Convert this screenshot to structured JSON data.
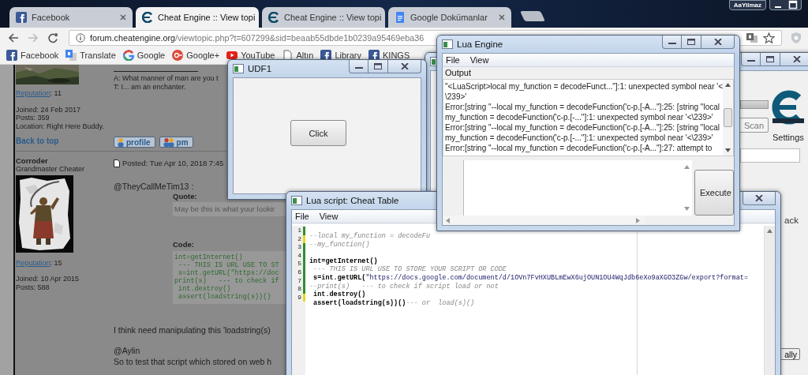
{
  "browser": {
    "tabs": [
      {
        "title": "Facebook",
        "selected": false
      },
      {
        "title": "Cheat Engine :: View topi",
        "selected": true
      },
      {
        "title": "Cheat Engine :: View topi",
        "selected": false
      },
      {
        "title": "Google Dokümanlar",
        "selected": false
      }
    ],
    "user": "AaYilmaz",
    "url": {
      "host": "forum.cheatengine.org",
      "path": "/viewtopic.php?t=607299&sid=beaab55dbde1b0239a95469eba36"
    },
    "bookmarks": [
      {
        "label": "Facebook"
      },
      {
        "label": "Translate"
      },
      {
        "label": "Google"
      },
      {
        "label": "Google+"
      },
      {
        "label": "YouTube"
      },
      {
        "label": "Altın"
      },
      {
        "label": "Library"
      },
      {
        "label": "KINGS"
      }
    ]
  },
  "forum": {
    "previous_post": {
      "reputation_link": "Reputation",
      "reputation_value": ": 11",
      "joined": "Joined: 24 Feb 2017",
      "posts": "Posts: 359",
      "location": "Location: Right Here Buddy.",
      "signature": [
        "A: What manner of man are you t",
        "T: I... am an enchanter."
      ],
      "back_to_top": "Back to top",
      "buttons": [
        "profile",
        "pm"
      ]
    },
    "post": {
      "author": "Corroder",
      "rank": "Grandmaster Cheater",
      "reputation_link": "Reputation",
      "reputation_value": ": 15",
      "joined": "Joined: 10 Apr 2015",
      "posts": "Posts: 588",
      "posted": "Posted: Tue Apr 10, 2018 7:45",
      "body": [
        {
          "kind": "text",
          "text": "@TheyCallMeTim13 :"
        },
        {
          "kind": "quote",
          "label": "Quote:",
          "text": "May be this is what your lookir"
        },
        {
          "kind": "code",
          "label": "Code:",
          "lines": [
            "int=getInternet()",
            " --- THIS IS URL USE TO ST",
            " s=int.getURL(\"https://doc",
            "print(s)   --- to check if",
            " int.destroy()",
            " assert(loadstring(s))()"
          ]
        },
        {
          "kind": "text",
          "text": "I think need manipulating this 'loadstring(s)"
        },
        {
          "kind": "text",
          "text": "@Aylin"
        },
        {
          "kind": "text",
          "text": "So to test that script which stored on web h"
        }
      ]
    }
  },
  "cheat_engine_window": {
    "scan_button": "Scan",
    "settings_label": "Settings",
    "label_fragment": "ack",
    "button_fragment": "ally"
  },
  "udf1_window": {
    "title": "UDF1",
    "button": "Click"
  },
  "lua_engine_window": {
    "title": "Lua Engine",
    "menu": [
      "File",
      "View"
    ],
    "output_label": "Output",
    "output_lines": [
      "\"<LuaScript>local my_function = decodeFunct...\"]:1: unexpected symbol near '<",
      "\\239>'",
      "Error:[string \"--local my_function = decodeFunction('c-p.[-A...\"]:25: [string \"local",
      "my_function = decodeFunction('c-p.[-...\"]:1: unexpected symbol near '<\\239>'",
      "Error:[string \"--local my_function = decodeFunction('c-p.[-A...\"]:25: [string \"local",
      "my_function = decodeFunction('c-p.[-...\"]:1: unexpected symbol near '<\\239>'",
      "Error:[string \"--local my_function = decodeFunction('c-p.[-A...\"]:27: attempt to"
    ],
    "execute_button": "Execute"
  },
  "lua_script_window": {
    "title": "Lua script: Cheat Table",
    "menu": [
      "File",
      "View"
    ],
    "lines": [
      {
        "number": "1",
        "color": "#2f8f2f",
        "segments": [
          {
            "kind": "comment",
            "text": "--local my_function = decodeFu"
          }
        ]
      },
      {
        "number": "2",
        "color": "#e8d81c",
        "segments": [
          {
            "kind": "comment",
            "text": "--my_function()"
          }
        ]
      },
      {
        "number": "3",
        "color": "#2f8f2f"
      },
      {
        "number": "4",
        "color": "#2f8f2f",
        "segments": [
          {
            "kind": "code",
            "text": "int=getInternet()"
          }
        ]
      },
      {
        "number": "5",
        "color": "#2f8f2f",
        "segments": [
          {
            "kind": "comment",
            "text": " --- THIS IS URL USE TO STORE YOUR SCRIPT OR CODE"
          }
        ]
      },
      {
        "number": "6",
        "color": "#2f8f2f",
        "segments": [
          {
            "kind": "code",
            "text": " s=int.getURL("
          },
          {
            "kind": "string",
            "text": "\"https://docs.google.com/document/d/1OVn7FvHXUBLmEwX6ujOUN1OU4WqJdb6eXo9aXGO3ZGw/export?format="
          }
        ]
      },
      {
        "number": "7",
        "color": "#2f8f2f",
        "segments": [
          {
            "kind": "comment",
            "text": "--print(s)   --- to check if script load or not"
          }
        ]
      },
      {
        "number": "8",
        "color": "#2f8f2f",
        "segments": [
          {
            "kind": "code",
            "text": " int.destroy()"
          }
        ]
      },
      {
        "number": "9",
        "color": "#e8d81c",
        "segments": [
          {
            "kind": "code",
            "text": " assert(loadstring(s))()"
          },
          {
            "kind": "comment",
            "text": "--- or  load(s)()"
          }
        ]
      }
    ]
  }
}
